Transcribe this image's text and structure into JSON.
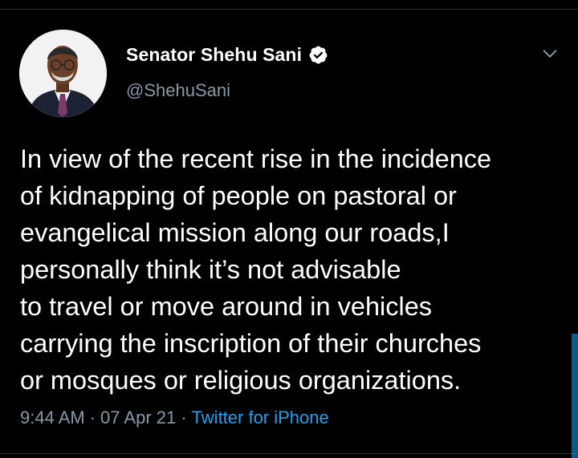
{
  "header": {
    "display_name": "Senator Shehu Sani",
    "handle": "@ShehuSani",
    "verified": true,
    "avatar_icon": "profile-photo",
    "more_icon": "chevron-down-icon"
  },
  "tweet": {
    "lines": [
      "In view of the recent rise in the incidence",
      "of kidnapping of people on pastoral or",
      "evangelical mission along our roads,I",
      "personally think it’s not advisable",
      "to travel or move around in vehicles",
      "carrying the inscription of their churches",
      "or mosques or religious organizations."
    ]
  },
  "meta": {
    "time": "9:44 AM",
    "separator": "·",
    "date": "07 Apr 21",
    "source": "Twitter for iPhone"
  },
  "colors": {
    "background": "#000000",
    "text": "#ffffff",
    "secondary": "#8899a6",
    "accent": "#1da1f2"
  }
}
